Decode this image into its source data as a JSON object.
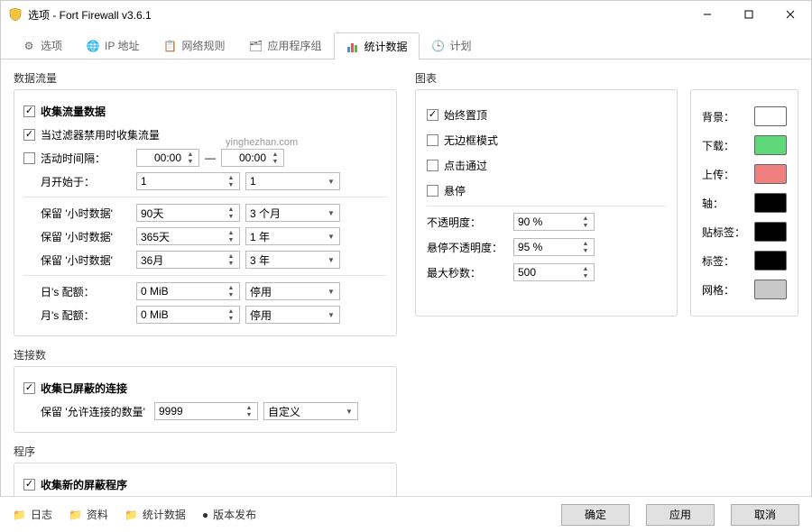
{
  "window": {
    "title": "选项 - Fort Firewall v3.6.1"
  },
  "tabs": {
    "options": "选项",
    "ip": "IP 地址",
    "rules": "网络规则",
    "apps": "应用程序组",
    "stats": "统计数据",
    "schedule": "计划"
  },
  "traffic": {
    "title": "数据流量",
    "collect": "收集流量数据",
    "collect_disabled": "当过滤器禁用时收集流量",
    "active_period": "活动时间隔：",
    "t1": "00:00",
    "dash": "—",
    "t2": "00:00",
    "month_start": "月开始于：",
    "month_spin": "1",
    "month_combo": "1",
    "keep_hour": "保留 '小时数据'",
    "hour_spin": "90天",
    "hour_combo": "3 个月",
    "keep_hour2": "保留 '小时数据'",
    "hour2_spin": "365天",
    "hour2_combo": "1 年",
    "keep_hour3": "保留 '小时数据'",
    "hour3_spin": "36月",
    "hour3_combo": "3 年",
    "day_quota": "日's 配额：",
    "day_spin": "0  MiB",
    "day_combo": "停用",
    "month_quota": "月's 配额：",
    "monthq_spin": "0  MiB",
    "monthq_combo": "停用"
  },
  "conn": {
    "title": "连接数",
    "collect_blocked": "收集已屏蔽的连接",
    "keep_allowed": "保留 '允许连接的数量'",
    "allowed_spin": "9999",
    "allowed_combo": "自定义"
  },
  "prog": {
    "title": "程序",
    "collect_new": "收集新的屏蔽程序"
  },
  "chart": {
    "title": "图表",
    "always_top": "始终置顶",
    "frameless": "无边框模式",
    "click_through": "点击通过",
    "hover": "悬停",
    "opacity_lbl": "不透明度：",
    "opacity": "90 %",
    "hover_opacity_lbl": "悬停不透明度：",
    "hover_opacity": "95 %",
    "max_sec_lbl": "最大秒数：",
    "max_sec": "500"
  },
  "colors": {
    "bg": "背景：",
    "bg_c": "#ffffff",
    "dl": "下载：",
    "dl_c": "#5fd87a",
    "ul": "上传：",
    "ul_c": "#f08080",
    "axis": "轴：",
    "axis_c": "#000000",
    "ticklabel": "贴标签：",
    "ticklabel_c": "#000000",
    "label": "标签：",
    "label_c": "#000000",
    "grid": "网格：",
    "grid_c": "#c8c8c8"
  },
  "footer": {
    "logs": "日志",
    "data": "资料",
    "stats": "统计数据",
    "release": "版本发布",
    "ok": "确定",
    "apply": "应用",
    "cancel": "取消"
  },
  "watermark": "yinghezhan.com"
}
